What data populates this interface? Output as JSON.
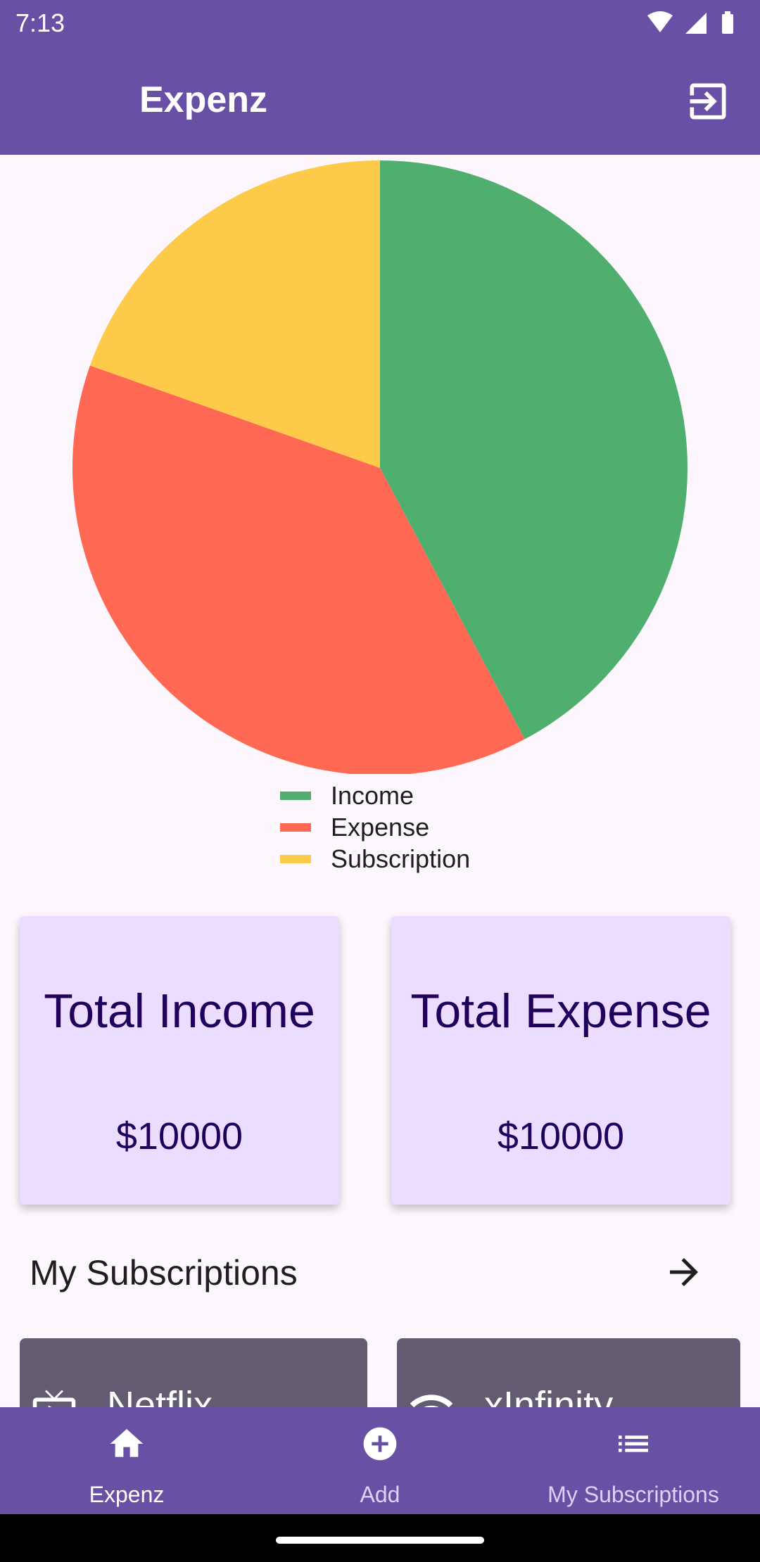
{
  "status_bar": {
    "time": "7:13",
    "icons": [
      "wifi-icon",
      "signal-icon",
      "battery-icon"
    ]
  },
  "app_bar": {
    "title": "Expenz",
    "action_icon": "logout-icon"
  },
  "chart_data": {
    "type": "pie",
    "labels": [
      "Income",
      "Expense",
      "Subscription"
    ],
    "values": [
      42.2,
      38.2,
      19.6
    ],
    "colors": [
      "#50AE6F",
      "#FF6852",
      "#FECA4A"
    ],
    "start_angle_deg": 0,
    "direction": "clockwise",
    "legend_position": "bottom"
  },
  "summary": {
    "income": {
      "title": "Total Income",
      "value": "$10000"
    },
    "expense": {
      "title": "Total Expense",
      "value": "$10000"
    }
  },
  "subscriptions": {
    "heading": "My Subscriptions",
    "items": [
      {
        "name": "Netflix",
        "icon": "tv-icon"
      },
      {
        "name": "xInfinity",
        "icon": "wifi-icon"
      }
    ]
  },
  "bottom_nav": {
    "items": [
      {
        "label": "Expenz",
        "icon": "home-icon",
        "active": true
      },
      {
        "label": "Add",
        "icon": "add-circle-icon",
        "active": false
      },
      {
        "label": "My Subscriptions",
        "icon": "list-icon",
        "active": false
      }
    ]
  }
}
